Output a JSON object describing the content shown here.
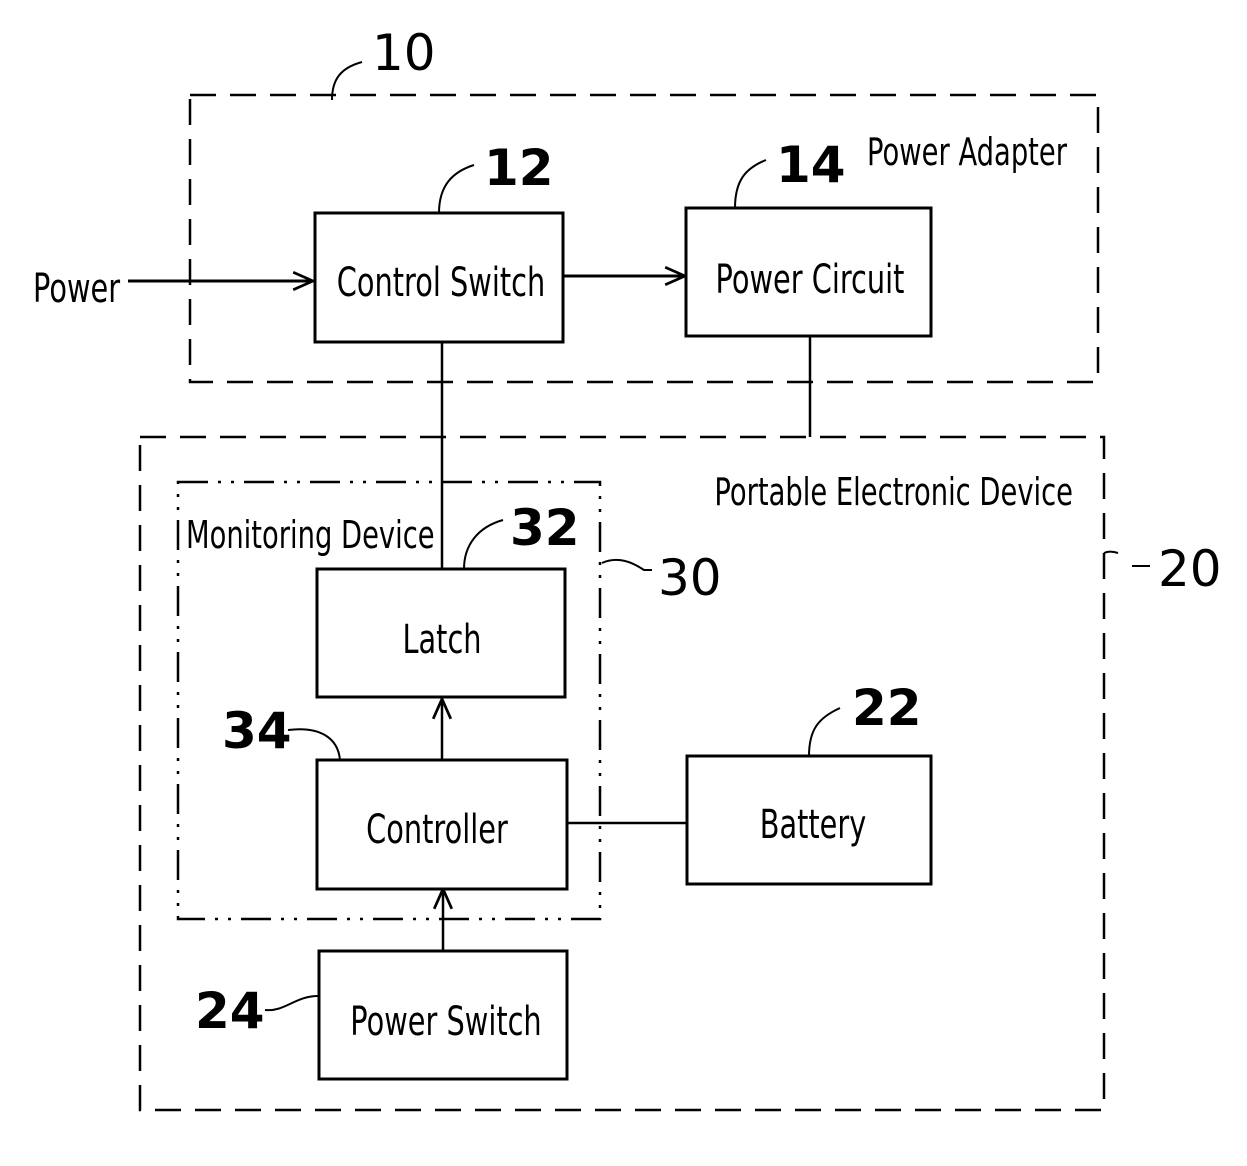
{
  "diagram": {
    "input_label": "Power",
    "regions": {
      "power_adapter": {
        "label": "Power Adapter",
        "ref": "10"
      },
      "portable_device": {
        "label": "Portable Electronic Device",
        "ref": "20"
      },
      "monitoring_device": {
        "label": "Monitoring Device",
        "ref": "30"
      }
    },
    "blocks": {
      "control_switch": {
        "label": "Control Switch",
        "ref": "12"
      },
      "power_circuit": {
        "label": "Power Circuit",
        "ref": "14"
      },
      "latch": {
        "label": "Latch",
        "ref": "32"
      },
      "controller": {
        "label": "Controller",
        "ref": "34"
      },
      "battery": {
        "label": "Battery",
        "ref": "22"
      },
      "power_switch": {
        "label": "Power Switch",
        "ref": "24"
      }
    },
    "connections": [
      {
        "from": "Power",
        "to": "Control Switch",
        "arrow": true
      },
      {
        "from": "Control Switch",
        "to": "Power Circuit",
        "arrow": true
      },
      {
        "from": "Control Switch",
        "to": "Latch",
        "arrow": false
      },
      {
        "from": "Power Circuit",
        "to": "Portable Electronic Device",
        "arrow": false
      },
      {
        "from": "Controller",
        "to": "Latch",
        "arrow": true
      },
      {
        "from": "Power Switch",
        "to": "Controller",
        "arrow": true
      },
      {
        "from": "Controller",
        "to": "Battery",
        "arrow": false
      }
    ]
  }
}
